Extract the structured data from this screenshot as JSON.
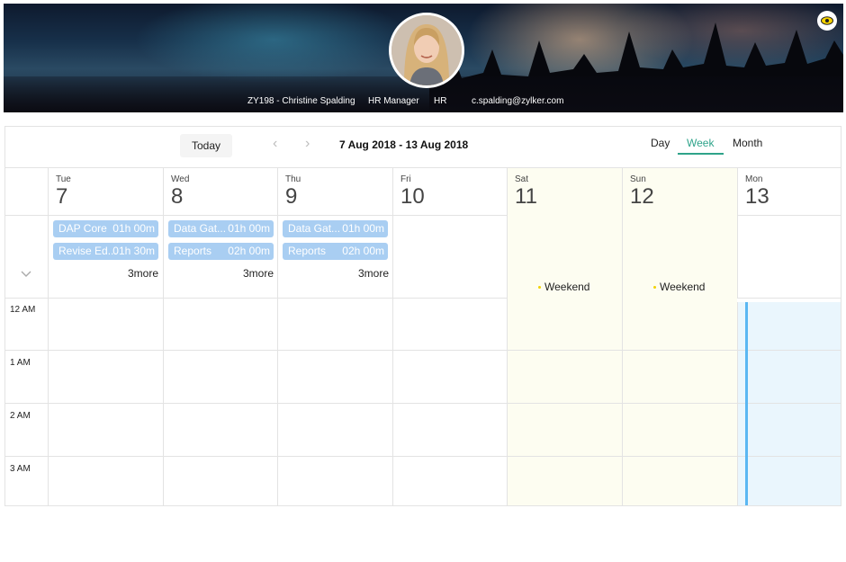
{
  "profile": {
    "id_name": "ZY198 - Christine Spalding",
    "role": "HR Manager",
    "department": "HR",
    "email": "c.spalding@zylker.com"
  },
  "toolbar": {
    "today_label": "Today",
    "prev_icon": "chevron-left-icon",
    "next_icon": "chevron-right-icon",
    "date_range": "7 Aug 2018 - 13 Aug 2018",
    "views": [
      "Day",
      "Week",
      "Month"
    ],
    "active_view": "Week"
  },
  "days": [
    {
      "name": "Tue",
      "num": "7"
    },
    {
      "name": "Wed",
      "num": "8"
    },
    {
      "name": "Thu",
      "num": "9"
    },
    {
      "name": "Fri",
      "num": "10"
    },
    {
      "name": "Sat",
      "num": "11"
    },
    {
      "name": "Sun",
      "num": "12"
    },
    {
      "name": "Mon",
      "num": "13"
    }
  ],
  "events": {
    "tue": [
      {
        "title": "DAP Core",
        "duration": "01h 00m"
      },
      {
        "title": "Revise Ed...",
        "duration": "01h 30m"
      }
    ],
    "wed": [
      {
        "title": "Data Gat...",
        "duration": "01h 00m"
      },
      {
        "title": "Reports",
        "duration": "02h 00m"
      }
    ],
    "thu": [
      {
        "title": "Data Gat...",
        "duration": "01h 00m"
      },
      {
        "title": "Reports",
        "duration": "02h 00m"
      }
    ],
    "more_label": "3more"
  },
  "weekend_label": "Weekend",
  "hours": [
    "12 AM",
    "1 AM",
    "2 AM",
    "3 AM"
  ],
  "colors": {
    "accent": "#2ea38a",
    "event_bg": "#a9cef2",
    "weekend_bg": "#fdfdf1",
    "today_bg": "#eaf6fd",
    "now_line": "#5ab7f2"
  }
}
